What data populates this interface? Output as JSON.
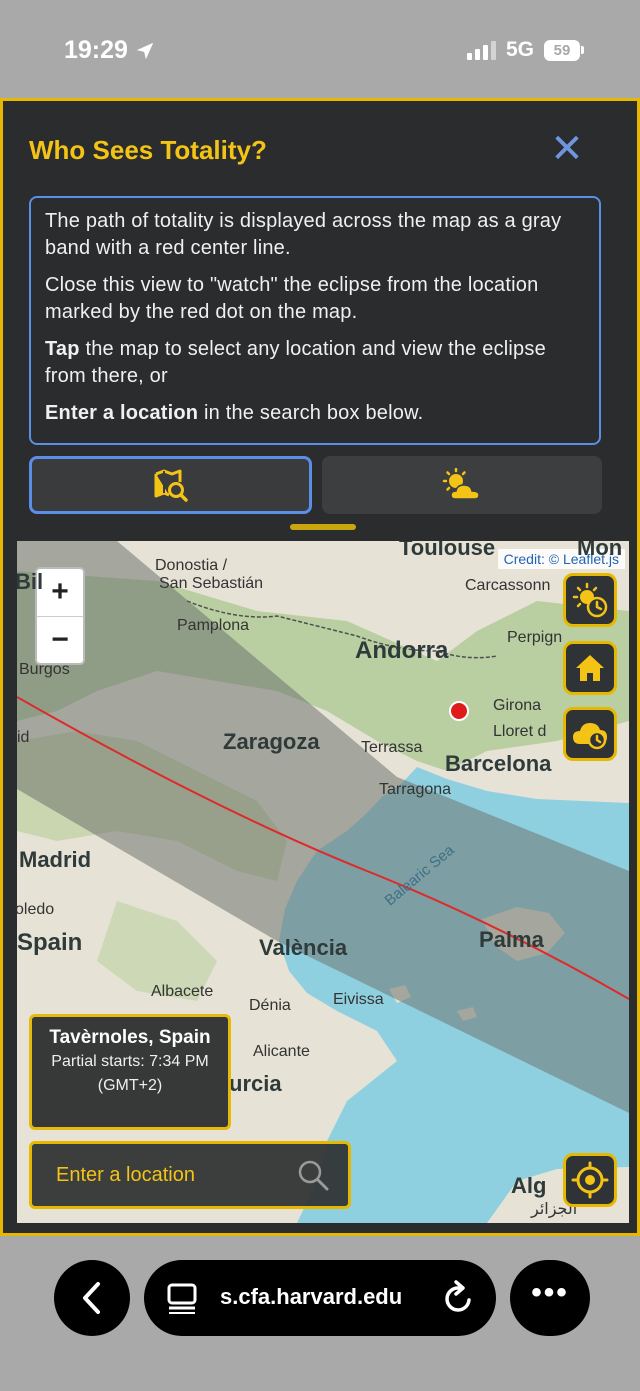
{
  "status": {
    "time": "19:29",
    "network": "5G",
    "battery": "59"
  },
  "panel": {
    "title": "Who Sees Totality?",
    "close_label": "✕",
    "info": {
      "p1": "The path of totality is displayed across the map as a gray band with a red center line.",
      "p2": "Close this view to \"watch\" the eclipse from the location marked by the red dot on the map.",
      "p3_bold": "Tap",
      "p3_rest": " the map to select any location and view the eclipse from there, or",
      "p4_bold": "Enter a location",
      "p4_rest": " in the search box below."
    },
    "tabs": [
      {
        "icon": "map-search-icon",
        "active": true
      },
      {
        "icon": "sun-cloud-icon",
        "active": false
      }
    ]
  },
  "map": {
    "credit": "Credit: © Leaflet.js",
    "zoom_in": "+",
    "zoom_out": "−",
    "labels": {
      "toulouse": "Toulouse",
      "mon": "Mon",
      "donostia": "Donostia /",
      "san_sebastian": "San Sebastián",
      "carcassonne": "Carcassonn",
      "bil": "Bil",
      "pamplona": "Pamplona",
      "andorra": "Andorra",
      "perpignan": "Perpign",
      "burgos": "Burgos",
      "girona": "Girona",
      "lloret": "Lloret d",
      "id": "id",
      "zaragoza": "Zaragoza",
      "terrassa": "Terrassa",
      "barcelona": "Barcelona",
      "tarragona": "Tarragona",
      "madrid": "Madrid",
      "balearic_sea": "Balearic Sea",
      "oledo": "oledo",
      "spain": "Spain",
      "valencia": "València",
      "palma": "Palma",
      "albacete": "Albacete",
      "denia": "Dénia",
      "eivissa": "Eivissa",
      "alicante": "Alicante",
      "urcia": "urcia",
      "alg": "Alg",
      "alg_ar": "الجزائر"
    },
    "location_card": {
      "name": "Tavèrnoles, Spain",
      "partial": "Partial starts: 7:34 PM (GMT+2)"
    },
    "search": {
      "placeholder": "Enter a location"
    },
    "buttons": [
      "eclipse-time-icon",
      "home-icon",
      "cloud-clock-icon",
      "locate-icon"
    ]
  },
  "browser": {
    "url": "s.cfa.harvard.edu",
    "more": "•••"
  },
  "colors": {
    "accent": "#e6b800",
    "title": "#f3c316",
    "info_border": "#5b8ee6",
    "panel_bg": "#2b2c2d"
  }
}
